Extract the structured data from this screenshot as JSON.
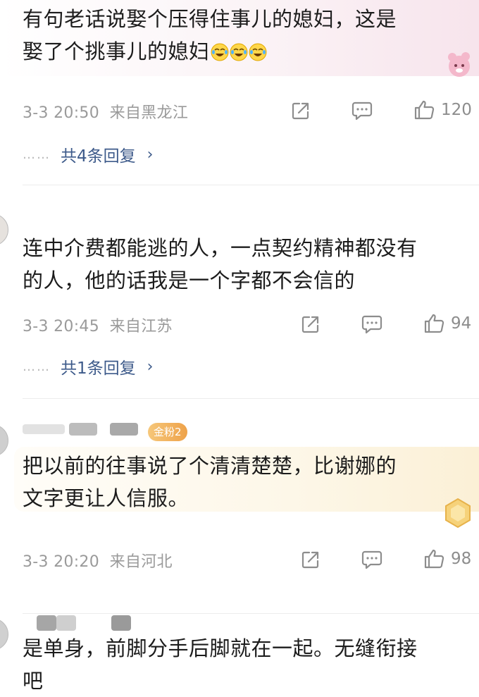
{
  "comments": [
    {
      "text_line1": "有句老话说娶个压得住事儿的媳妇，这是",
      "text_line2": "娶了个挑事儿的媳妇",
      "emojis": [
        "laugh-cry-emoji",
        "laugh-cry-emoji",
        "laugh-cry-emoji"
      ],
      "time": "3-3 20:50",
      "location": "来自黑龙江",
      "likes": "120",
      "replies_dots": "……",
      "replies_label": "共4条回复",
      "bubble_color": "#f7e4ec"
    },
    {
      "text_line1": "连中介费都能逃的人，一点契约精神都没有",
      "text_line2": "的人，他的话我是一个字都不会信的",
      "time": "3-3 20:45",
      "location": "来自江苏",
      "likes": "94",
      "replies_dots": "……",
      "replies_label": "共1条回复"
    },
    {
      "badge": "金粉2",
      "text_line1": "把以前的往事说了个清清楚楚，比谢娜的",
      "text_line2": "文字更让人信服。",
      "time": "3-3 20:20",
      "location": "来自河北",
      "likes": "98",
      "bubble_color": "#fbf0d6"
    },
    {
      "text_line1": "是单身，前脚分手后脚就在一起。无缝衔接",
      "text_line2": "吧"
    }
  ],
  "colors": {
    "meta_gray": "#9a9a9a",
    "reply_link": "#3d5a8a",
    "badge_gold": "#eea24a"
  },
  "icons": [
    "share-icon",
    "comment-icon",
    "thumbs-up-icon",
    "chevron-right-icon",
    "laugh-cry-emoji"
  ]
}
